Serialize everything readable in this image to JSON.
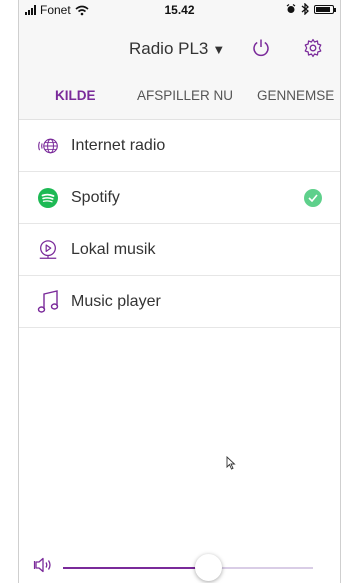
{
  "status_bar": {
    "carrier": "Fonet",
    "time": "15.42"
  },
  "header": {
    "device_name": "Radio PL3",
    "device_caret": "▼"
  },
  "tabs": [
    {
      "label": "KILDE",
      "active": true
    },
    {
      "label": "AFSPILLER NU",
      "active": false
    },
    {
      "label": "GENNEMSE",
      "active": false
    }
  ],
  "sources": [
    {
      "label": "Internet radio",
      "icon": "globe-radio-icon",
      "selected": false
    },
    {
      "label": "Spotify",
      "icon": "spotify-icon",
      "selected": true
    },
    {
      "label": "Lokal musik",
      "icon": "media-server-icon",
      "selected": false
    },
    {
      "label": "Music player",
      "icon": "music-note-icon",
      "selected": false
    }
  ],
  "volume": {
    "level": 0.58
  },
  "colors": {
    "accent": "#7a2a9a",
    "check": "#5ed08b",
    "spotify": "#1db954",
    "header_bg": "#f7f7f7"
  }
}
